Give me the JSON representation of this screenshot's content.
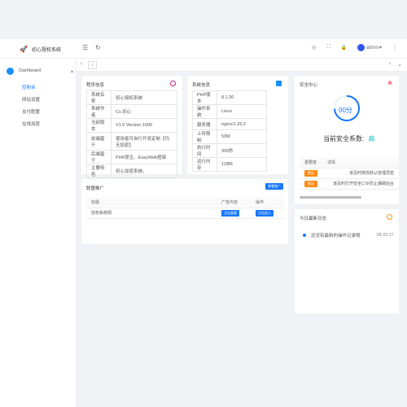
{
  "app": {
    "title": "初心授权系统"
  },
  "topbar": {
    "user": "admin"
  },
  "sidebar": {
    "header": "Dashboard",
    "items": [
      "控制台",
      "网站设置",
      "支付配置",
      "在线加密"
    ]
  },
  "program_info": {
    "title": "程序信息",
    "rows": [
      [
        "系统名称",
        "初心授权系统"
      ],
      [
        "系统作者",
        "Cx.初心"
      ],
      [
        "当前版本",
        "V1.0 Version 1000"
      ],
      [
        "前端基于",
        "使用者可自行开发定制【均无加密】"
      ],
      [
        "后端基于",
        "PHP原生、EasyWeb框架"
      ],
      [
        "主要特色",
        "初心加密系统。"
      ]
    ]
  },
  "system_info": {
    "title": "系统信息",
    "rows": [
      [
        "PHP版本",
        "8.1.30"
      ],
      [
        "操作系统",
        "Linux"
      ],
      [
        "服务器",
        "nginx/1.26.2"
      ],
      [
        "上传限制",
        "50M"
      ],
      [
        "执行时间",
        "300秒"
      ],
      [
        "运行内存",
        "128M"
      ]
    ]
  },
  "security": {
    "title": "安全中心",
    "score_text": "00分",
    "score_label": "当前安全系数:",
    "score_level": "高",
    "columns": [
      "重要度",
      "详情"
    ],
    "rows": [
      {
        "level": "警告",
        "detail": "该及时修改默认管理员密"
      },
      {
        "level": "警告",
        "detail": "该及时打开安全口令防止爆破后台"
      }
    ]
  },
  "alliance": {
    "title": "联盟推广",
    "button": "查看推广",
    "columns": [
      "标题",
      "广告内容",
      "操作"
    ],
    "rows": [
      {
        "title": "授权系统网",
        "content_btn": "点击查看",
        "action_btn": "点击进入"
      }
    ]
  },
  "log": {
    "title": "今日最新日志",
    "entries": [
      {
        "text": "还没有最新的操作记录哦",
        "time": "08:20:27"
      }
    ]
  }
}
